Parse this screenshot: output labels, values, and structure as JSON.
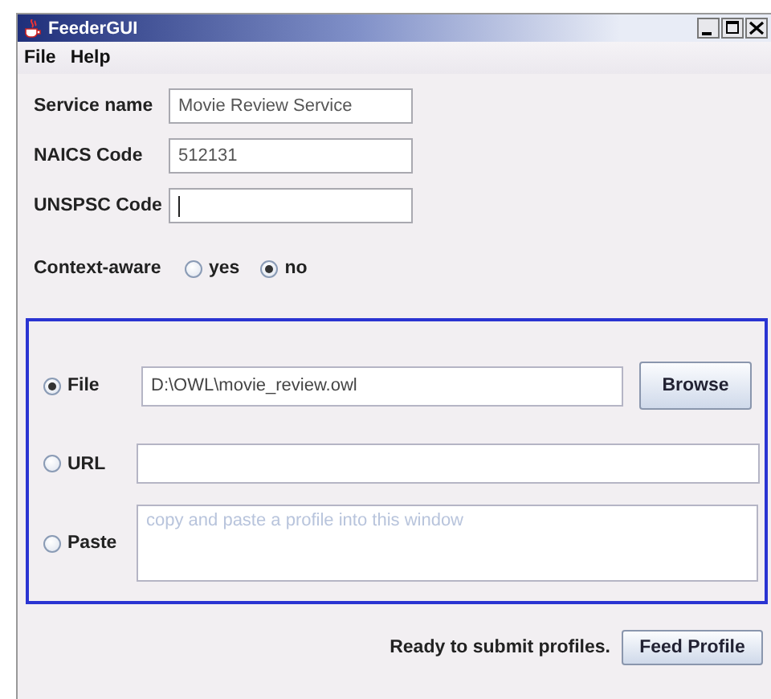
{
  "window": {
    "title": "FeederGUI"
  },
  "menu": [
    "File",
    "Help"
  ],
  "fields": [
    {
      "label": "Service name",
      "value": "Movie Review Service",
      "focused": false
    },
    {
      "label": "NAICS Code",
      "value": "512131",
      "focused": false
    },
    {
      "label": "UNSPSC Code",
      "focused": true
    }
  ],
  "context_aware": {
    "label": "Context-aware",
    "options": [
      {
        "label": "yes",
        "selected": false
      },
      {
        "label": "no",
        "selected": true
      }
    ]
  },
  "source": [
    {
      "kind": "file",
      "label": "File",
      "selected": true,
      "value": "D:\\OWL\\movie_review.owl",
      "button": "Browse"
    },
    {
      "kind": "url",
      "label": "URL",
      "selected": false
    },
    {
      "kind": "paste",
      "label": "Paste",
      "selected": false,
      "placeholder": "copy and paste a profile into this window"
    }
  ],
  "footer": {
    "status": "Ready to submit profiles.",
    "button": "Feed Profile"
  }
}
